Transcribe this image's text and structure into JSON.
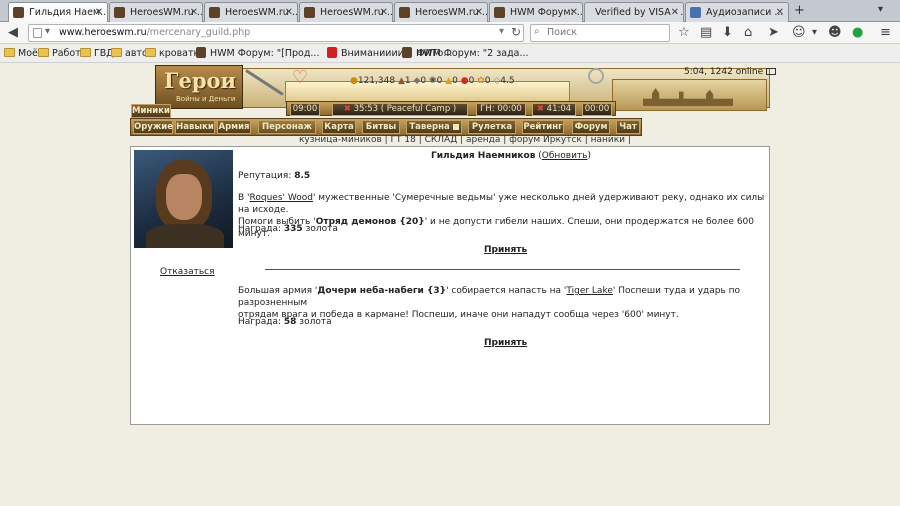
{
  "browser": {
    "tabs": [
      {
        "label": "Гильдия Наем..."
      },
      {
        "label": "HeroesWM.ru ..."
      },
      {
        "label": "HeroesWM.ru ..."
      },
      {
        "label": "HeroesWM.ru ..."
      },
      {
        "label": "HeroesWM.ru ..."
      },
      {
        "label": "HWM Форум: ..."
      },
      {
        "label": "Verified by VISA - ..."
      },
      {
        "label": "Аудиозаписи ..."
      }
    ],
    "url_host": "www.heroeswm.ru",
    "url_path": "/mercenary_guild.php",
    "search_placeholder": "Поиск",
    "bookmarks": [
      "Моё",
      "Работа",
      "ГВД",
      "авто",
      "кроватки",
      "HWM Форум: \"[Прод...",
      "Вниманиииие! ФИТо...",
      "HWM Форум: \"2 зада..."
    ]
  },
  "game": {
    "logo_title": "Герои",
    "logo_subtitle": "Войны и Деньги",
    "minions_label": "Миники",
    "resources": [
      "121,348",
      "1",
      "0",
      "0",
      "0",
      "0",
      "0",
      "4.5"
    ],
    "online_status": "5:04, 1242 online",
    "timers": {
      "left_time": "09:00",
      "camp_time": "35:53",
      "camp_label": "( Peaceful Camp )",
      "gn": "ГН: 00:00",
      "mid_time": "41:04",
      "right_time": "00:00"
    },
    "menu": [
      "Оружие",
      "Навыки",
      "Армия",
      "Персонаж",
      "Карта",
      "Битвы",
      "Таверна",
      "Рулетка",
      "Рейтинг",
      "Форум",
      "Чат"
    ],
    "sublinks": "кузница-миников | ГТ 18 | СКЛАД | аренда | форум Иркутск | наники |"
  },
  "guild": {
    "title": "Гильдия Наемников",
    "refresh": "Обновить",
    "reputation_label": "Репутация:",
    "reputation_value": "8.5",
    "decline": "Отказаться",
    "quest1": {
      "pre": "В '",
      "location": "Roques' Wood",
      "mid": "' мужественные 'Сумеречные ведьмы' уже несколько дней удерживают реку, однако их силы на исходе.",
      "line2_pre": "Помоги выбить '",
      "target": "Отряд демонов {20}",
      "line2_post": "' и не допусти гибели наших. Спеши, они продержатся не более 600 минут.",
      "reward_label": "Награда:",
      "reward_value": "335",
      "reward_unit": "золота",
      "accept": "Принять"
    },
    "quest2": {
      "pre": "Большая армия '",
      "target": "Дочери неба-набеги {3}",
      "mid": "' собирается напасть на '",
      "location": "Tiger Lake",
      "post": "' Поспеши туда и ударь по разрозненным",
      "line2": "отрядам врага и победа в кармане! Поспеши, иначе они нападут сообща через '600' минут.",
      "reward_label": "Награда:",
      "reward_value": "58",
      "reward_unit": "золота",
      "accept": "Принять"
    }
  }
}
